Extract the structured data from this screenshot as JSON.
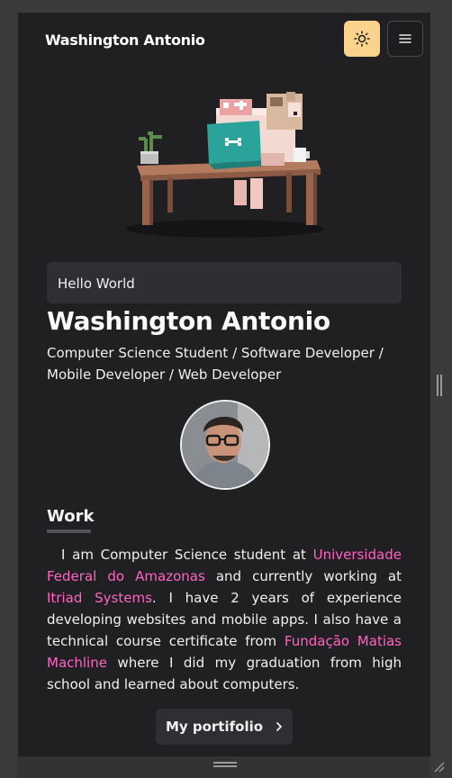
{
  "navbar": {
    "brand": "Washington Antonio",
    "theme_toggle_icon": "sun-icon",
    "menu_icon": "hamburger-icon",
    "theme_color": "#fbd38d"
  },
  "hero": {
    "illustration": "voxel-desk-with-dog-and-laptop"
  },
  "hello": {
    "text": "Hello World"
  },
  "profile": {
    "name": "Washington Antonio",
    "roles": "Computer Science Student / Software Developer / Mobile Developer / Web Developer"
  },
  "work": {
    "title": "Work",
    "p1": "I am Computer Science student at ",
    "link1": "Universidade Federal do Amazonas",
    "p2": " and currently working at ",
    "link2": "Itriad Systems",
    "p3": ". I have 2 years of experience developing websites and mobile apps. I also have a technical course certificate from ",
    "link3": "Fundação Matias Machline",
    "p4": " where I did my graduation from high school and learned about computers.",
    "link_color": "#ff63c3"
  },
  "portfolio": {
    "label": "My portifolio",
    "icon": "chevron-right-icon"
  }
}
